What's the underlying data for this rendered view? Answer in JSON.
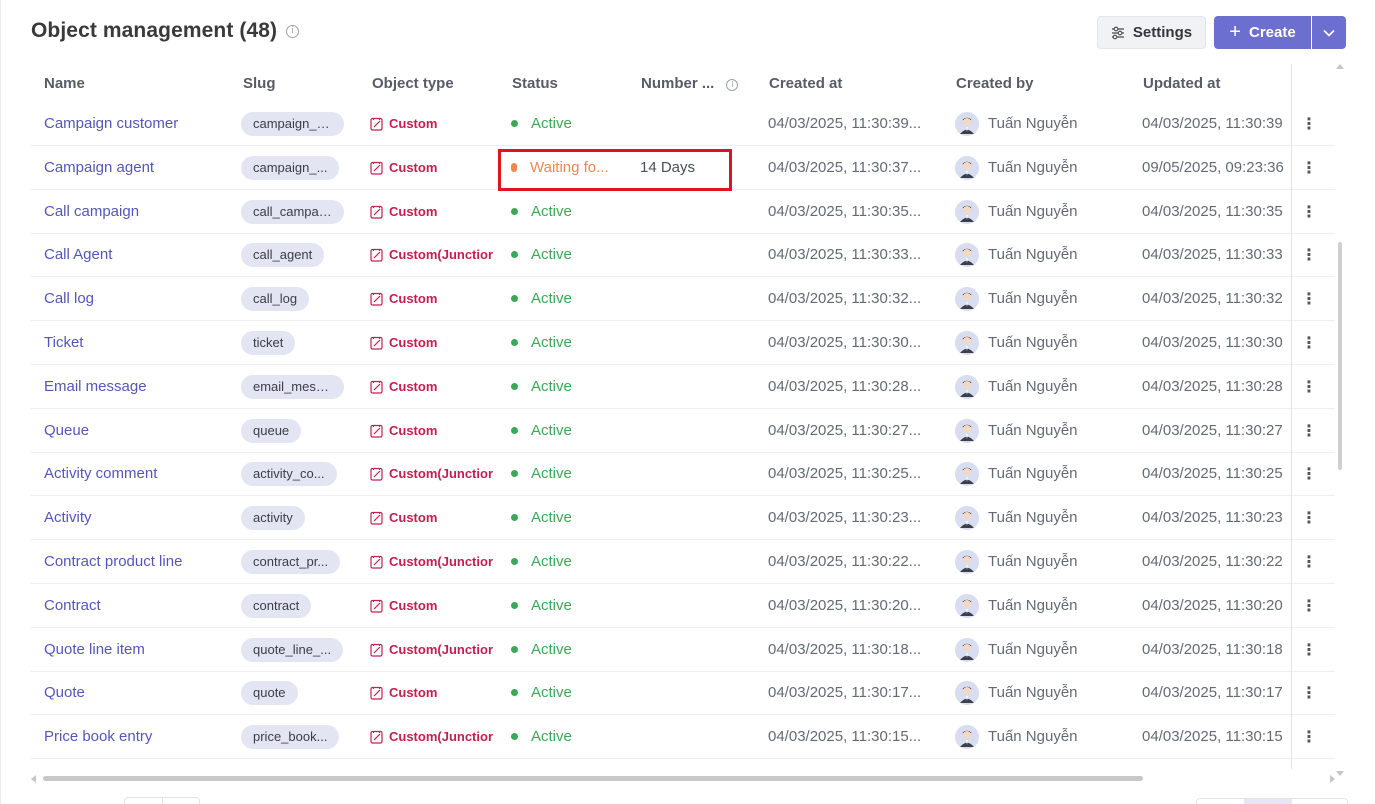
{
  "header": {
    "title": "Object management (48)",
    "info_glyph": "i",
    "settings_label": "Settings",
    "create_label": "Create",
    "create_plus": "+"
  },
  "table": {
    "columns": [
      "Name",
      "Slug",
      "Object type",
      "Status",
      "Number ...",
      "Created at",
      "Created by",
      "Updated at"
    ],
    "rows": [
      {
        "name": "Campaign customer",
        "slug": "campaign_c...",
        "type": "Custom",
        "status": "Active",
        "days": "",
        "created_at": "04/03/2025, 11:30:39...",
        "created_by": "Tuấn Nguyễn",
        "updated_at": "04/03/2025, 11:30:39"
      },
      {
        "name": "Campaign agent",
        "slug": "campaign_...",
        "type": "Custom",
        "status": "Waiting fo...",
        "days": "14 Days",
        "created_at": "04/03/2025, 11:30:37...",
        "created_by": "Tuấn Nguyễn",
        "updated_at": "09/05/2025, 09:23:36"
      },
      {
        "name": "Call campaign",
        "slug": "call_campai...",
        "type": "Custom",
        "status": "Active",
        "days": "",
        "created_at": "04/03/2025, 11:30:35...",
        "created_by": "Tuấn Nguyễn",
        "updated_at": "04/03/2025, 11:30:35"
      },
      {
        "name": "Call Agent",
        "slug": "call_agent",
        "type": "Custom(Junctior",
        "status": "Active",
        "days": "",
        "created_at": "04/03/2025, 11:30:33...",
        "created_by": "Tuấn Nguyễn",
        "updated_at": "04/03/2025, 11:30:33"
      },
      {
        "name": "Call log",
        "slug": "call_log",
        "type": "Custom",
        "status": "Active",
        "days": "",
        "created_at": "04/03/2025, 11:30:32...",
        "created_by": "Tuấn Nguyễn",
        "updated_at": "04/03/2025, 11:30:32"
      },
      {
        "name": "Ticket",
        "slug": "ticket",
        "type": "Custom",
        "status": "Active",
        "days": "",
        "created_at": "04/03/2025, 11:30:30...",
        "created_by": "Tuấn Nguyễn",
        "updated_at": "04/03/2025, 11:30:30"
      },
      {
        "name": "Email message",
        "slug": "email_mess...",
        "type": "Custom",
        "status": "Active",
        "days": "",
        "created_at": "04/03/2025, 11:30:28...",
        "created_by": "Tuấn Nguyễn",
        "updated_at": "04/03/2025, 11:30:28"
      },
      {
        "name": "Queue",
        "slug": "queue",
        "type": "Custom",
        "status": "Active",
        "days": "",
        "created_at": "04/03/2025, 11:30:27...",
        "created_by": "Tuấn Nguyễn",
        "updated_at": "04/03/2025, 11:30:27"
      },
      {
        "name": "Activity comment",
        "slug": "activity_co...",
        "type": "Custom(Junctior",
        "status": "Active",
        "days": "",
        "created_at": "04/03/2025, 11:30:25...",
        "created_by": "Tuấn Nguyễn",
        "updated_at": "04/03/2025, 11:30:25"
      },
      {
        "name": "Activity",
        "slug": "activity",
        "type": "Custom",
        "status": "Active",
        "days": "",
        "created_at": "04/03/2025, 11:30:23...",
        "created_by": "Tuấn Nguyễn",
        "updated_at": "04/03/2025, 11:30:23"
      },
      {
        "name": "Contract product line",
        "slug": "contract_pr...",
        "type": "Custom(Junctior",
        "status": "Active",
        "days": "",
        "created_at": "04/03/2025, 11:30:22...",
        "created_by": "Tuấn Nguyễn",
        "updated_at": "04/03/2025, 11:30:22"
      },
      {
        "name": "Contract",
        "slug": "contract",
        "type": "Custom",
        "status": "Active",
        "days": "",
        "created_at": "04/03/2025, 11:30:20...",
        "created_by": "Tuấn Nguyễn",
        "updated_at": "04/03/2025, 11:30:20"
      },
      {
        "name": "Quote line item",
        "slug": "quote_line_...",
        "type": "Custom(Junctior",
        "status": "Active",
        "days": "",
        "created_at": "04/03/2025, 11:30:18...",
        "created_by": "Tuấn Nguyễn",
        "updated_at": "04/03/2025, 11:30:18"
      },
      {
        "name": "Quote",
        "slug": "quote",
        "type": "Custom",
        "status": "Active",
        "days": "",
        "created_at": "04/03/2025, 11:30:17...",
        "created_by": "Tuấn Nguyễn",
        "updated_at": "04/03/2025, 11:30:17"
      },
      {
        "name": "Price book entry",
        "slug": "price_book...",
        "type": "Custom(Junctior",
        "status": "Active",
        "days": "",
        "created_at": "04/03/2025, 11:30:15...",
        "created_by": "Tuấn Nguyễn",
        "updated_at": "04/03/2025, 11:30:15"
      }
    ],
    "row_action_glyph": "⋮"
  },
  "colors": {
    "accent": "#6c6fd0",
    "link": "#5457b8",
    "custom_type": "#c4204f",
    "active": "#3aa957",
    "waiting": "#f0874e",
    "highlight": "#e1131b"
  }
}
